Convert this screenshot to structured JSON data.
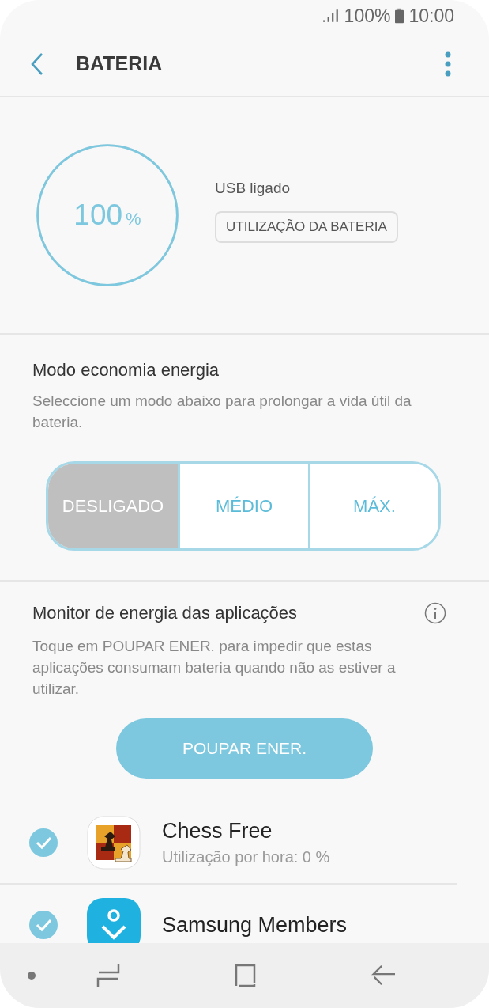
{
  "status_bar": {
    "battery": "100%",
    "time": "10:00"
  },
  "header": {
    "title": "BATERIA"
  },
  "battery": {
    "percent": "100",
    "unit": "%",
    "level": 1,
    "state": "USB ligado",
    "usage_button": "UTILIZAÇÃO DA BATERIA"
  },
  "power_saving": {
    "title": "Modo economia energia",
    "description": "Seleccione um modo abaixo para prolongar a vida útil da bateria.",
    "modes": [
      {
        "label": "DESLIGADO",
        "selected": true
      },
      {
        "label": "MÉDIO",
        "selected": false
      },
      {
        "label": "MÁX.",
        "selected": false
      }
    ]
  },
  "app_monitor": {
    "title": "Monitor de energia das aplicações",
    "description": "Toque em POUPAR ENER. para impedir que estas aplicações consumam bateria quando não as estiver a utilizar.",
    "button": "POUPAR ENER.",
    "apps": [
      {
        "name": "Chess Free",
        "usage": "Utilização por hora: 0 %",
        "checked": true,
        "kind": "chess"
      },
      {
        "name": "Samsung Members",
        "checked": true,
        "kind": "members"
      }
    ]
  }
}
